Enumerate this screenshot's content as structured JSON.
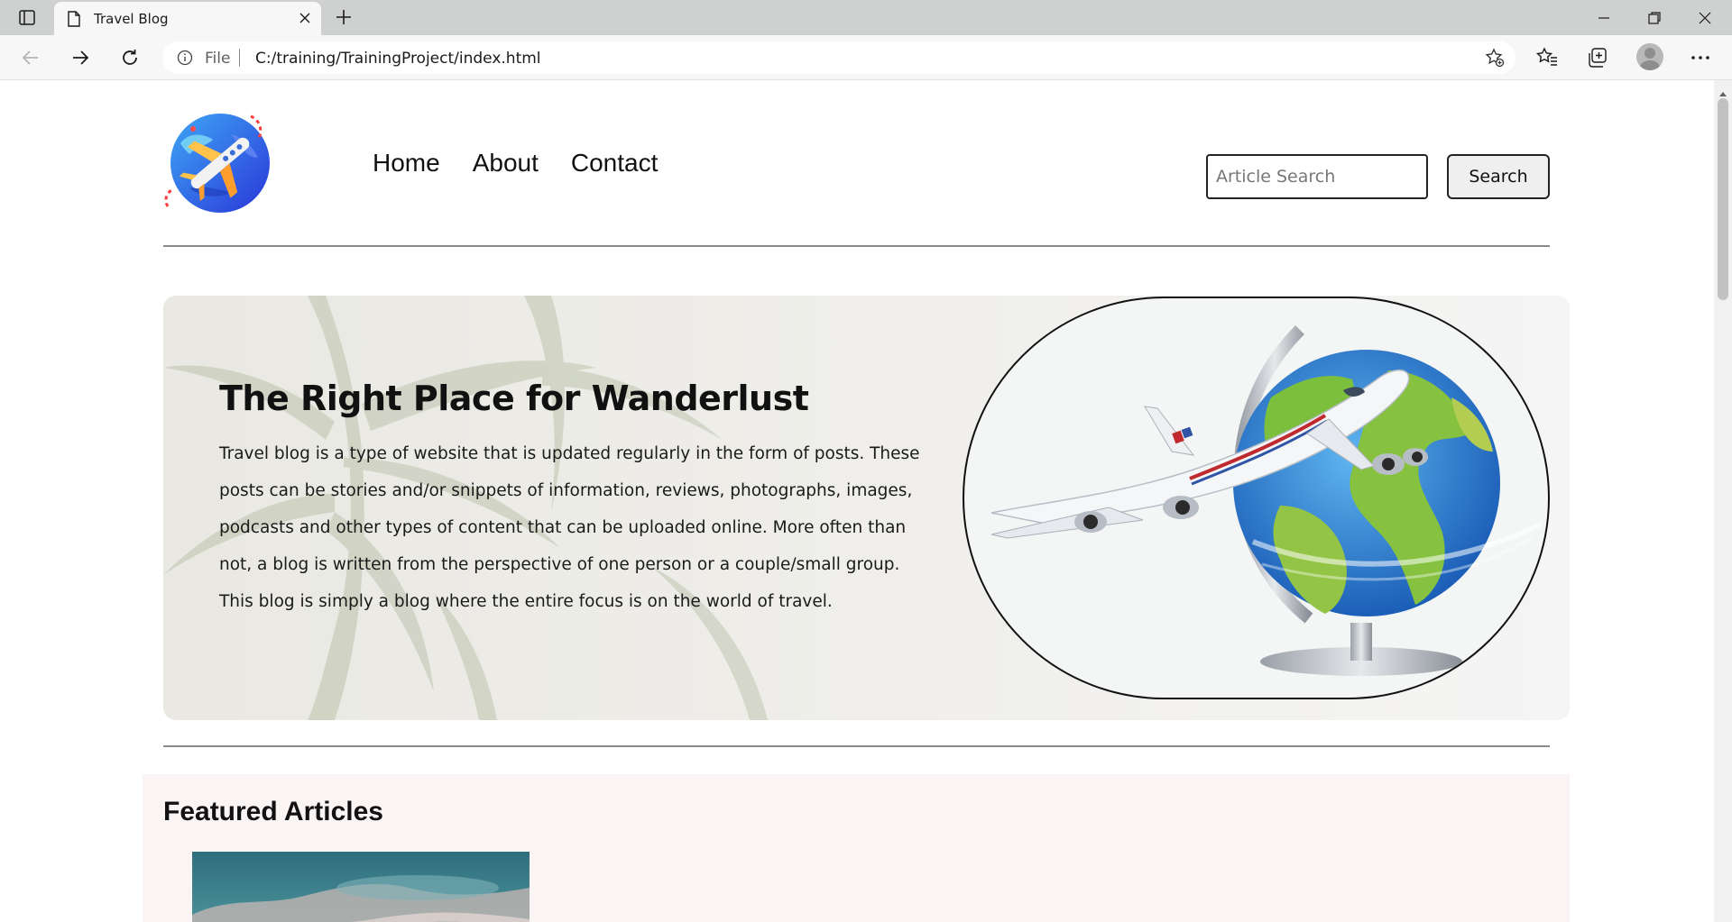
{
  "browser": {
    "tab": {
      "title": "Travel Blog"
    },
    "address": {
      "scheme": "File",
      "url": "C:/training/TrainingProject/index.html"
    }
  },
  "site": {
    "nav": [
      {
        "label": "Home"
      },
      {
        "label": "About"
      },
      {
        "label": "Contact"
      }
    ],
    "search": {
      "placeholder": "Article Search",
      "button_label": "Search"
    },
    "hero": {
      "title": "The Right Place for Wanderlust",
      "paragraph": "Travel blog is a type of website that is updated regularly in the form of posts. These posts can be stories and/or snippets of information, reviews, photographs, images, podcasts and other types of content that can be uploaded online. More often than not, a blog is written from the perspective of one person or a couple/small group.",
      "paragraph2": "This blog is simply a blog where the entire focus is on the world of travel."
    },
    "featured": {
      "title": "Featured Articles"
    }
  },
  "icons": {
    "tab_actions": "tab-actions-icon",
    "page": "page-icon",
    "close": "close-icon",
    "new_tab": "plus-icon",
    "back": "back-arrow-icon",
    "forward": "forward-arrow-icon",
    "reload": "reload-icon",
    "info": "info-icon",
    "add_favorite": "star-add-icon",
    "favorites": "favorites-icon",
    "collections": "collections-icon",
    "profile": "profile-avatar",
    "more": "more-dots-icon"
  },
  "colors": {
    "tabbar": "#cfd0d0",
    "toolbar": "#f7f7f7",
    "featured_bg": "#faf5f4",
    "hero_bg": "#f1f1f0"
  }
}
